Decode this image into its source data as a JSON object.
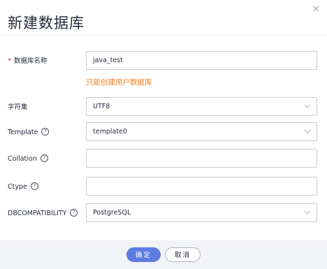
{
  "dialog": {
    "title": "新建数据库",
    "close_glyph": "×"
  },
  "form": {
    "required_mark": "*",
    "name": {
      "label": "数据库名称",
      "value": "java_test",
      "hint": "只能创建用户数据库"
    },
    "charset": {
      "label": "字符集",
      "value": "UTF8"
    },
    "template": {
      "label": "Template",
      "value": "template0"
    },
    "collation": {
      "label": "Collation",
      "value": ""
    },
    "ctype": {
      "label": "Ctype",
      "value": ""
    },
    "dbcompat": {
      "label": "DBCOMPATIBILITY",
      "value": "PostgreSQL"
    },
    "help_glyph": "?"
  },
  "footer": {
    "ok_label": "确定",
    "cancel_label": "取消"
  },
  "colors": {
    "primary": "#5e7ce0",
    "hint": "#f57c1f",
    "required": "#e02f2f"
  },
  "icons": {
    "close": "close-icon",
    "help": "help-circle-icon",
    "dropdown": "chevron-down-icon"
  }
}
